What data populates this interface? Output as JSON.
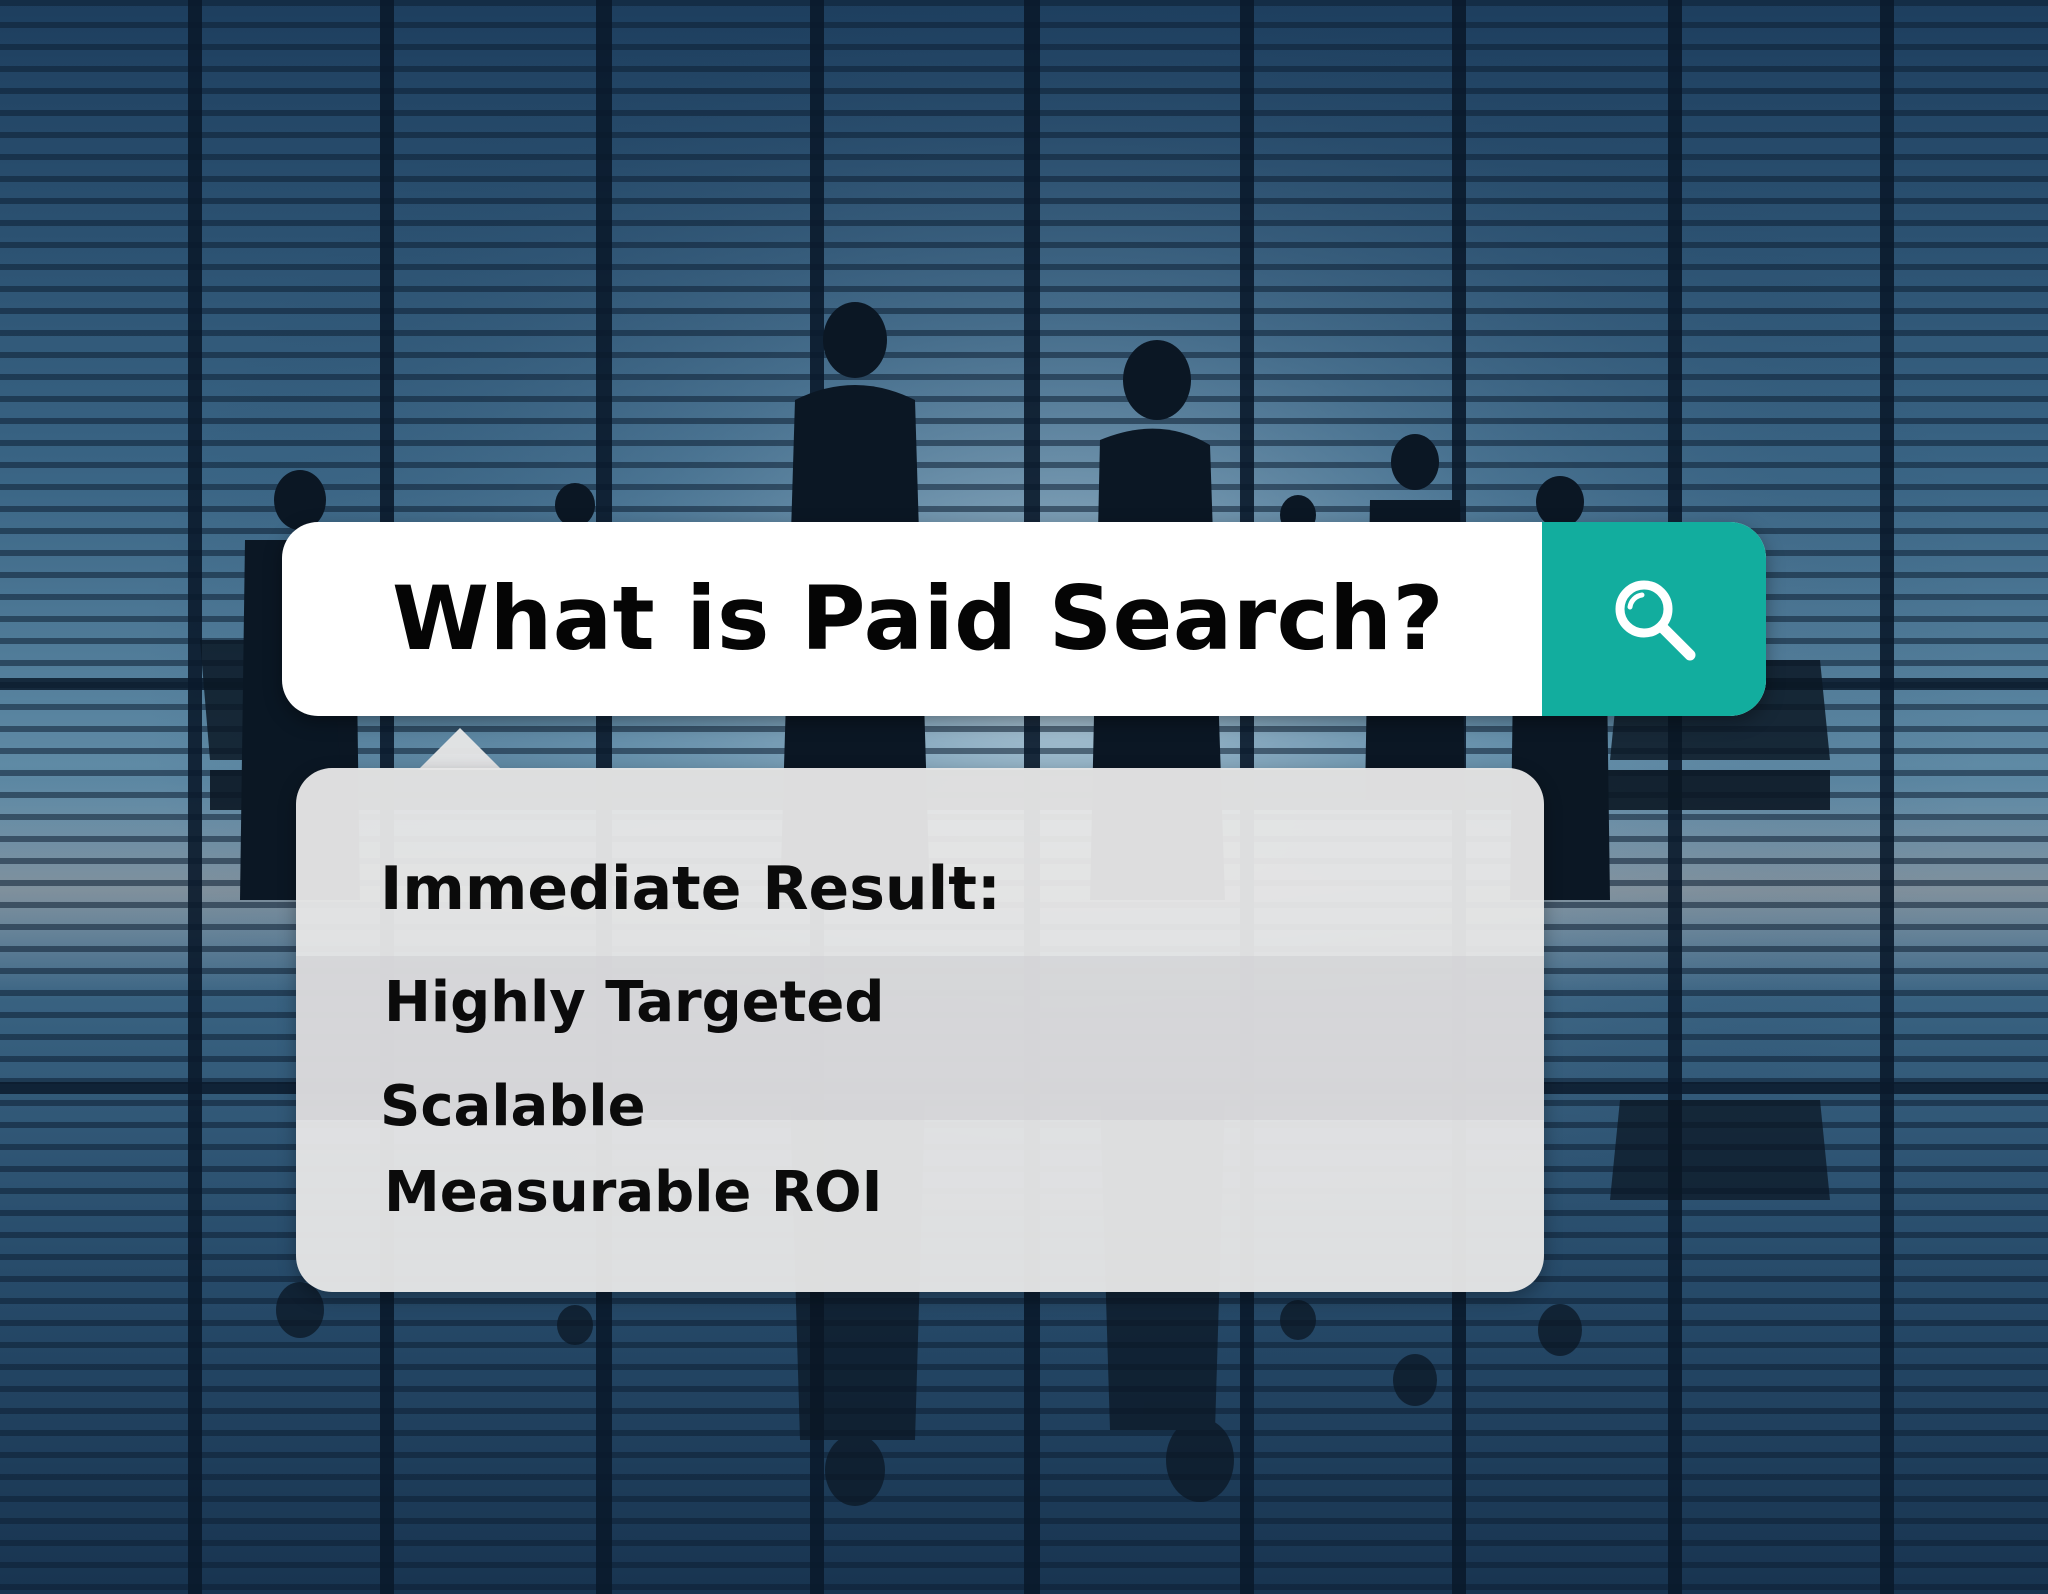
{
  "search": {
    "query": "What is Paid Search?",
    "button_icon": "search-icon",
    "accent_color": "#12ad9e"
  },
  "dropdown": {
    "items": [
      "Immediate Result:",
      "Highly Targeted",
      "Scalable",
      "Measurable ROI"
    ]
  },
  "background": {
    "description_icon": "office-meeting-photo"
  }
}
